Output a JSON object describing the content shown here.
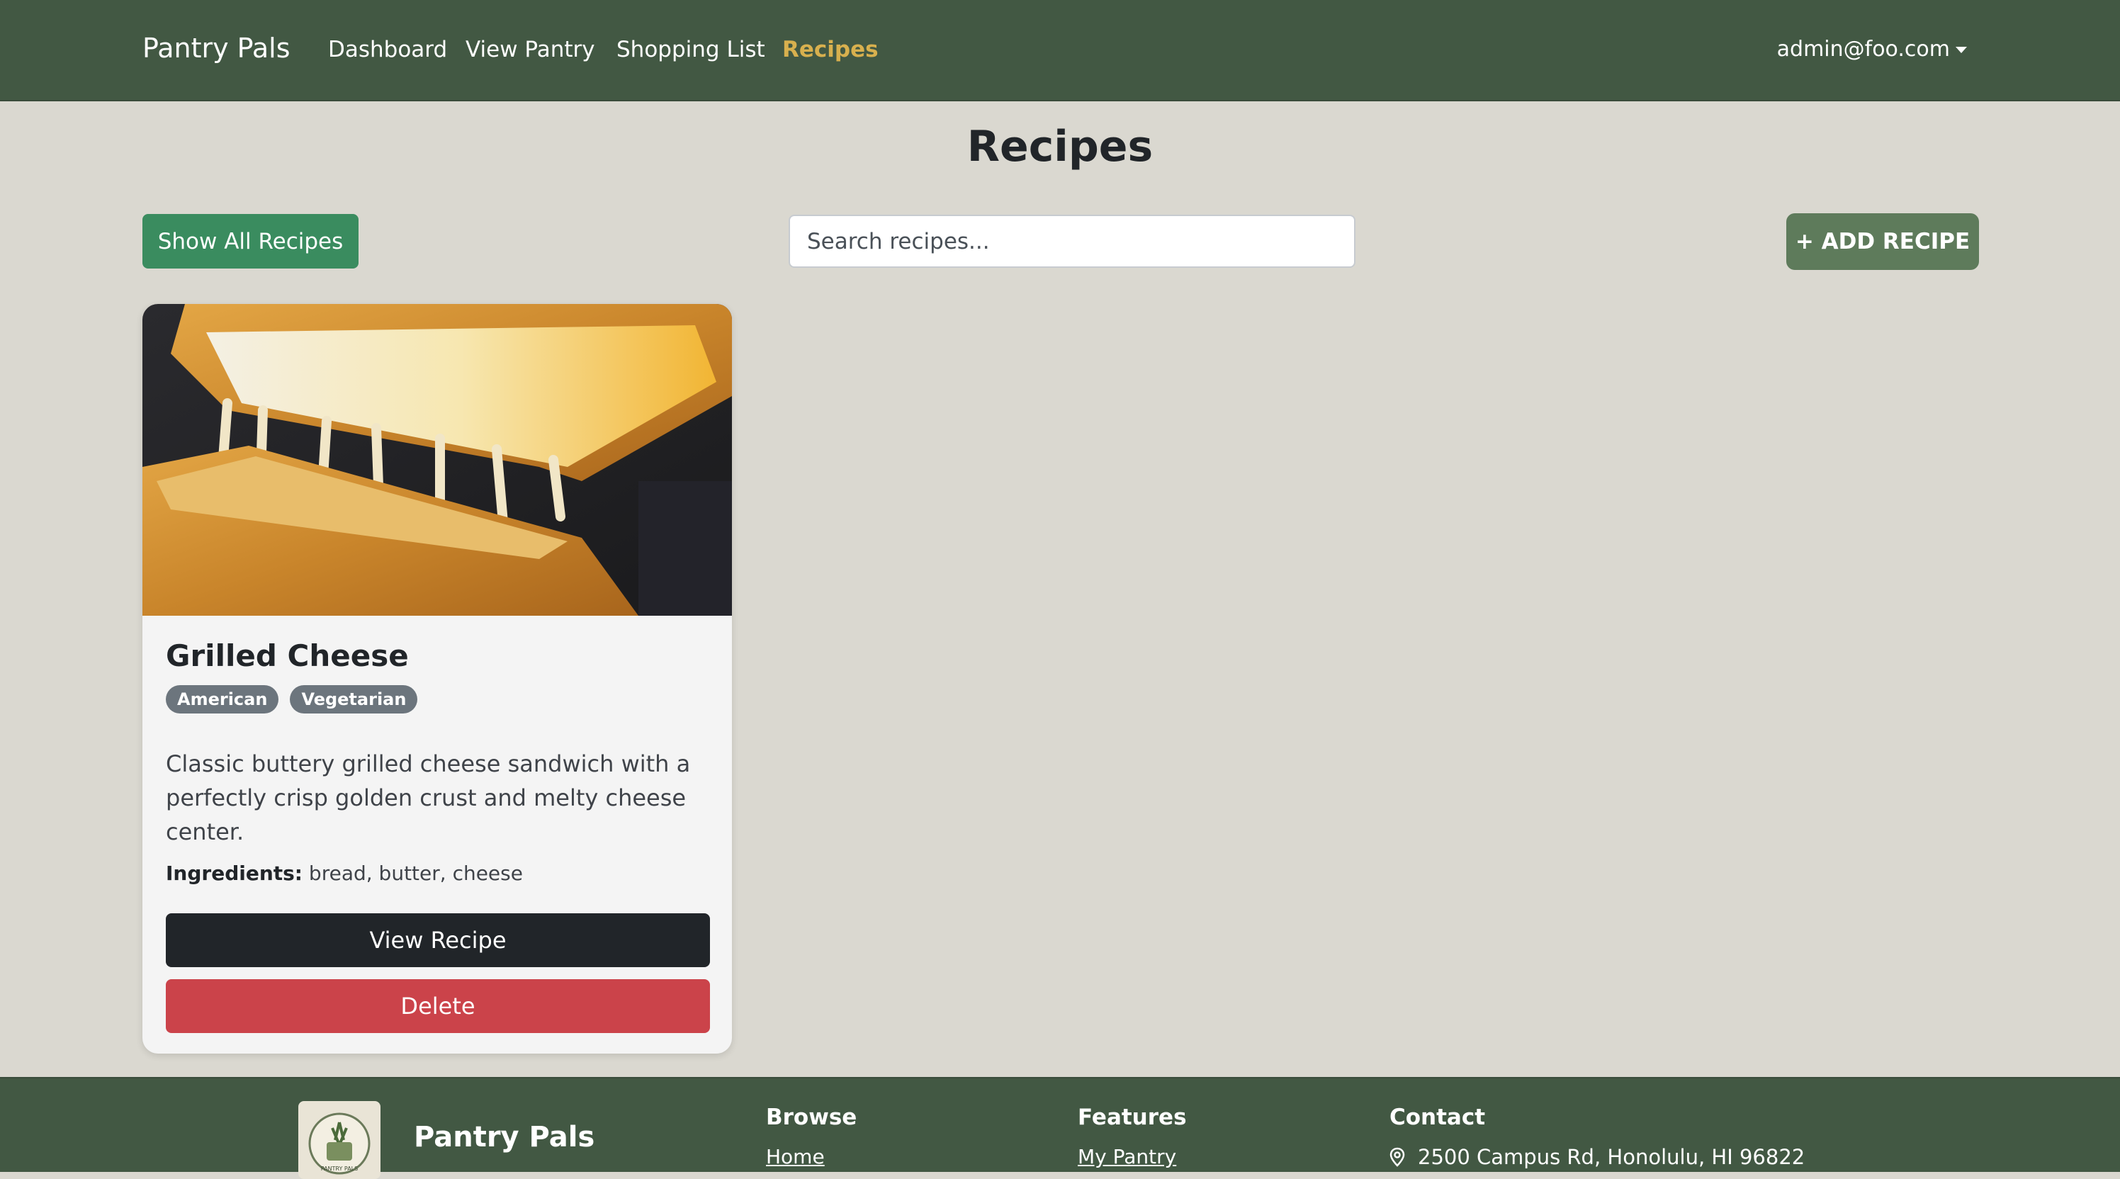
{
  "nav": {
    "brand": "Pantry Pals",
    "links": [
      "Dashboard",
      "View Pantry",
      "Shopping List",
      "Recipes"
    ],
    "active": "Recipes",
    "user": "admin@foo.com"
  },
  "page": {
    "title": "Recipes",
    "show_all_label": "Show All Recipes",
    "search_placeholder": "Search recipes...",
    "add_label": "+ ADD RECIPE"
  },
  "recipes": [
    {
      "title": "Grilled Cheese",
      "tags": [
        "American",
        "Vegetarian"
      ],
      "description": "Classic buttery grilled cheese sandwich with a perfectly crisp golden crust and melty cheese center.",
      "ingredients_label": "Ingredients:",
      "ingredients": "bread, butter, cheese",
      "view_label": "View Recipe",
      "delete_label": "Delete"
    }
  ],
  "footer": {
    "brand": "Pantry Pals",
    "logo_text": "PANTRY PALS",
    "browse": {
      "heading": "Browse",
      "link": "Home"
    },
    "features": {
      "heading": "Features",
      "link": "My Pantry"
    },
    "contact": {
      "heading": "Contact",
      "address": "2500 Campus Rd, Honolulu, HI 96822"
    }
  },
  "colors": {
    "navbar": "#425843",
    "background": "#dad8d0",
    "active_link": "#d8b04e",
    "show_all": "#3a8c5f",
    "add": "#5e7b5b",
    "view": "#212529",
    "delete": "#cb434a",
    "tag": "#6c757d"
  },
  "icons": {
    "user_menu": "caret-down-icon",
    "address": "map-pin-icon"
  }
}
